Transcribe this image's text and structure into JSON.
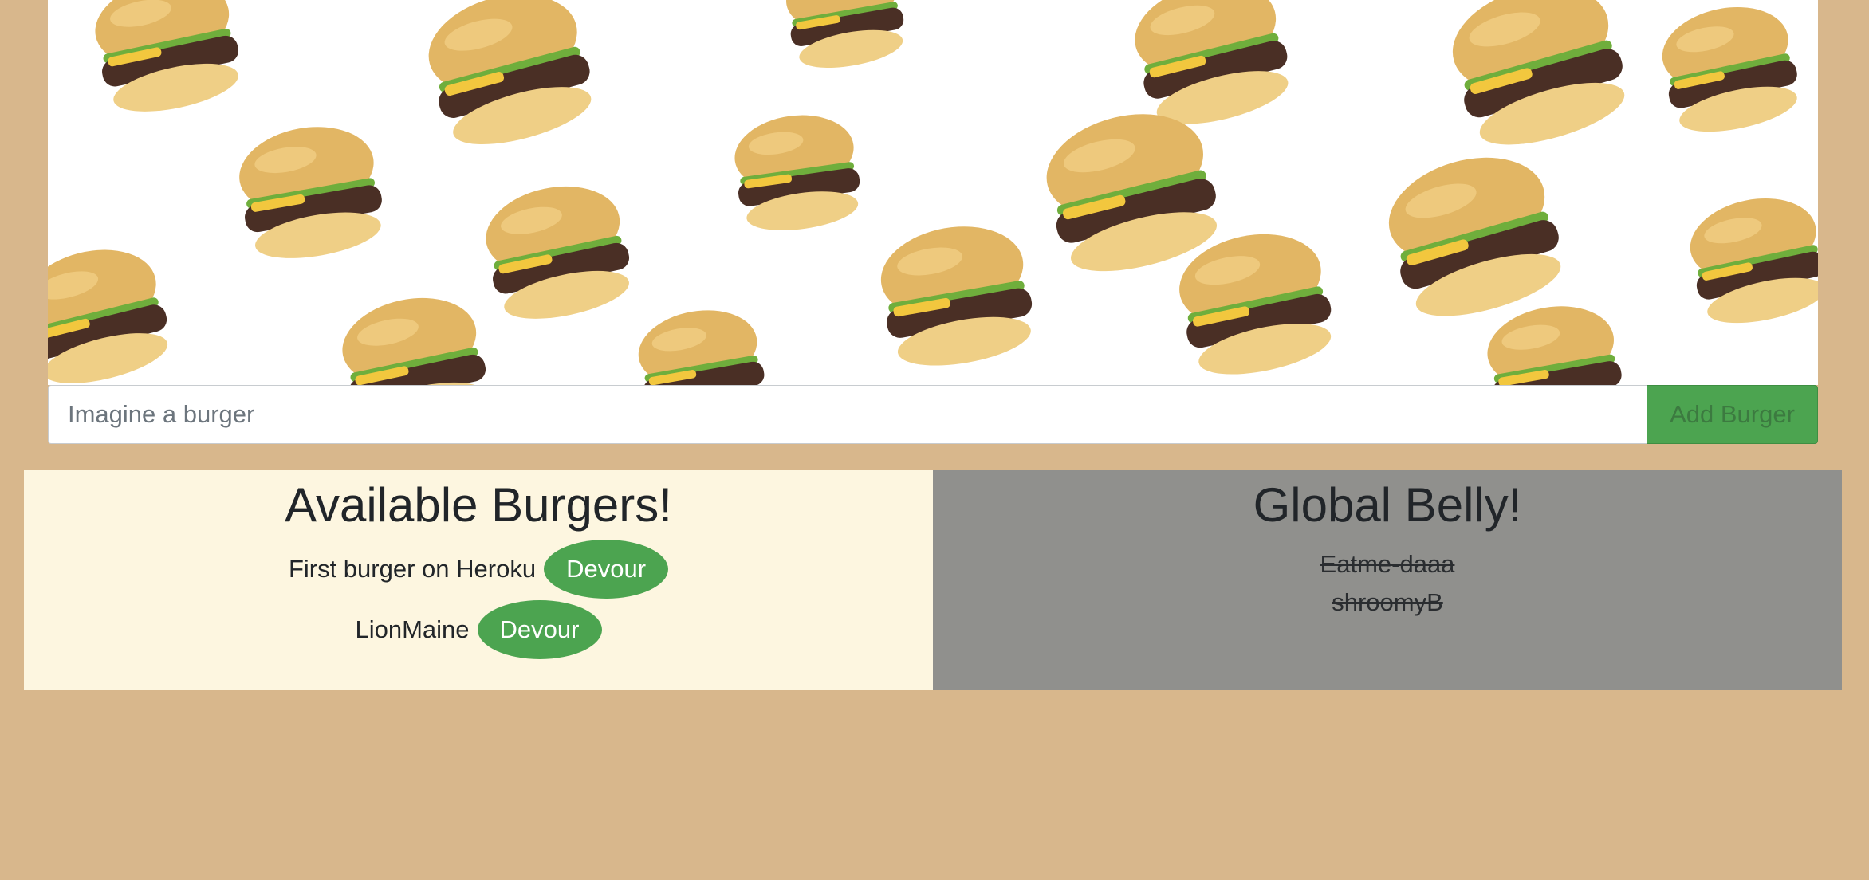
{
  "form": {
    "input_placeholder": "Imagine a burger",
    "input_value": "",
    "add_button_label": "Add Burger"
  },
  "available": {
    "heading": "Available Burgers!",
    "burgers": [
      {
        "name": "First burger on Heroku",
        "button_label": "Devour"
      },
      {
        "name": "LionMaine",
        "button_label": "Devour"
      }
    ]
  },
  "devoured": {
    "heading": "Global Belly!",
    "burgers": [
      {
        "name": "Eatme-daaa"
      },
      {
        "name": "shroomyB"
      }
    ]
  },
  "colors": {
    "page_background": "#d8b78c",
    "accent_green": "#4ca450",
    "available_panel": "#fdf6e0",
    "belly_panel": "#90908d"
  }
}
